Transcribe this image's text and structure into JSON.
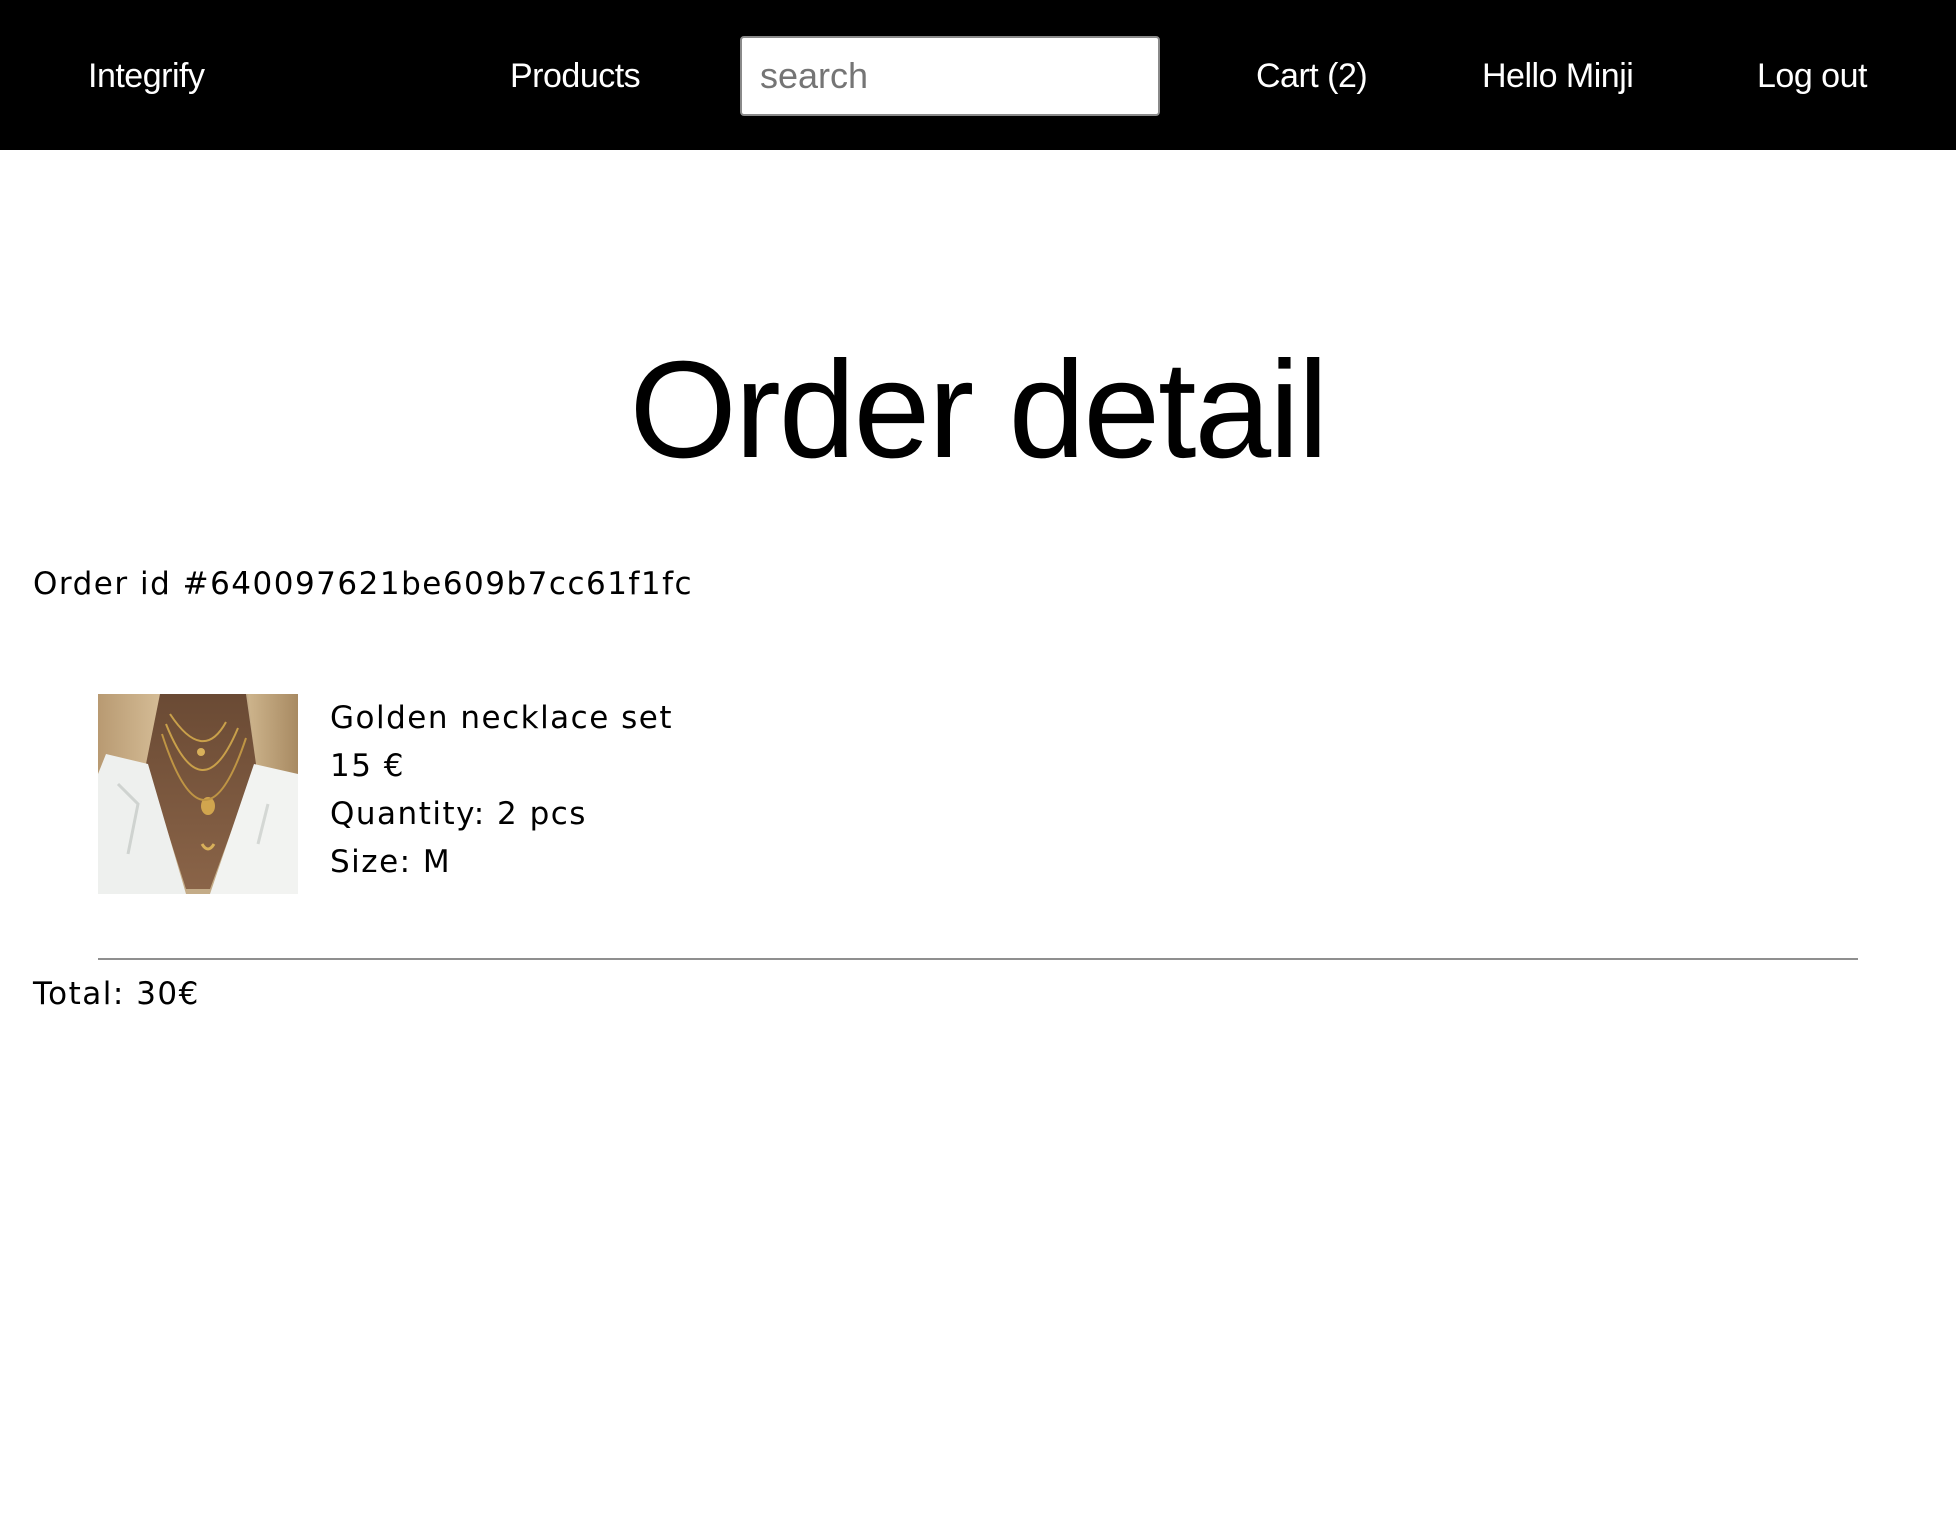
{
  "nav": {
    "brand": "Integrify",
    "products": "Products",
    "search_placeholder": "search",
    "search_value": "",
    "cart": "Cart (2)",
    "greeting": "Hello Minji",
    "logout": "Log out"
  },
  "page": {
    "title": "Order detail",
    "order_id": "Order id #640097621be609b7cc61f1fc"
  },
  "items": [
    {
      "image_icon": "necklace-product-photo",
      "name": "Golden necklace set",
      "price": "15 €",
      "quantity": "Quantity: 2 pcs",
      "size": "Size: M"
    }
  ],
  "summary": {
    "total": "Total: 30€"
  },
  "colors": {
    "navbar_bg": "#000000",
    "nav_text": "#ffffff",
    "page_bg": "#ffffff",
    "text": "#000000",
    "divider": "#8f8f8f"
  }
}
